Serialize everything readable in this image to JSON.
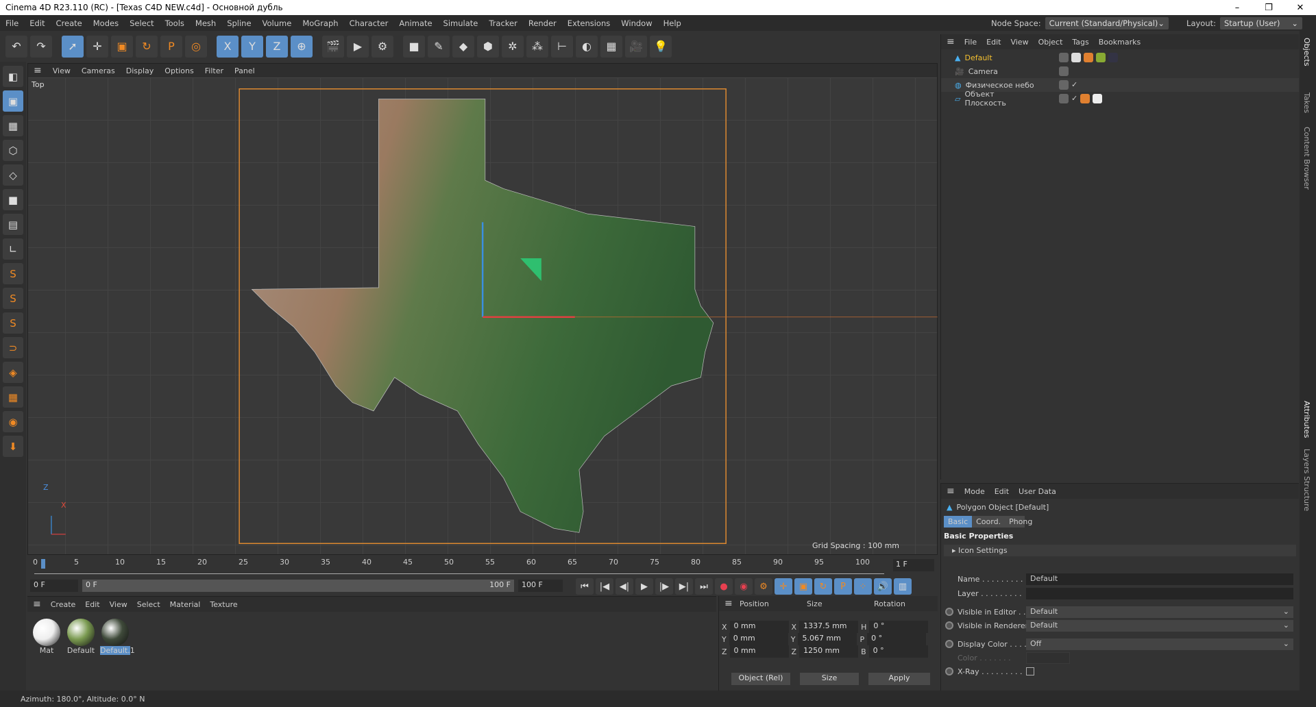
{
  "window": {
    "title": "Cinema 4D R23.110 (RC) - [Texas C4D NEW.c4d] - Основной дубль",
    "controls": [
      "–",
      "❐",
      "✕"
    ]
  },
  "menu": [
    "File",
    "Edit",
    "Create",
    "Modes",
    "Select",
    "Tools",
    "Mesh",
    "Spline",
    "Volume",
    "MoGraph",
    "Character",
    "Animate",
    "Simulate",
    "Tracker",
    "Render",
    "Extensions",
    "Window",
    "Help"
  ],
  "node_space": {
    "label": "Node Space:",
    "value": "Current (Standard/Physical)"
  },
  "layout": {
    "label": "Layout:",
    "value": "Startup (User)"
  },
  "toolbar": [
    {
      "icon": "undo-icon",
      "g": "↶"
    },
    {
      "icon": "redo-icon",
      "g": "↷"
    },
    {
      "icon": "select-icon",
      "g": "➚",
      "on": true
    },
    {
      "icon": "move-icon",
      "g": "✛"
    },
    {
      "icon": "scale-icon",
      "g": "▣"
    },
    {
      "icon": "rotate-icon",
      "g": "↻"
    },
    {
      "icon": "psr-icon",
      "g": "P"
    },
    {
      "icon": "recent-tool-icon",
      "g": "◎"
    },
    {
      "icon": "x-axis-icon",
      "g": "X",
      "on": true
    },
    {
      "icon": "y-axis-icon",
      "g": "Y",
      "on": true
    },
    {
      "icon": "z-axis-icon",
      "g": "Z",
      "on": true
    },
    {
      "icon": "coord-system-icon",
      "g": "⊕",
      "on": true
    },
    {
      "icon": "render-view-icon",
      "g": "🎬"
    },
    {
      "icon": "render-picture-viewer-icon",
      "g": "▶"
    },
    {
      "icon": "render-settings-icon",
      "g": "⚙"
    },
    {
      "icon": "cube-icon",
      "g": "■"
    },
    {
      "icon": "pen-icon",
      "g": "✎"
    },
    {
      "icon": "subdivision-icon",
      "g": "◆"
    },
    {
      "icon": "extrude-icon",
      "g": "⬢"
    },
    {
      "icon": "cloner-icon",
      "g": "✲"
    },
    {
      "icon": "mograph-icon",
      "g": "⁂"
    },
    {
      "icon": "deformer-icon",
      "g": "⊢"
    },
    {
      "icon": "field-icon",
      "g": "◐"
    },
    {
      "icon": "floor-icon",
      "g": "▦"
    },
    {
      "icon": "camera-icon",
      "g": "🎥"
    },
    {
      "icon": "light-icon",
      "g": "💡"
    }
  ],
  "left_tools": [
    "make-editable-icon",
    "model-mode-icon",
    "texture-mode-icon",
    "points-mode-icon",
    "edges-mode-icon",
    "polygons-mode-icon",
    "uv-mode-icon",
    "axis-icon",
    "snap-icon",
    "solo-icon",
    "solo-hierarchy-icon",
    "magnet-icon",
    "workplane-icon",
    "grid-icon",
    "locked-workplane-icon",
    "floor-icon"
  ],
  "viewport": {
    "menu": [
      "View",
      "Cameras",
      "Display",
      "Options",
      "Filter",
      "Panel"
    ],
    "label": "Top",
    "grid_spacing": "Grid Spacing : 100 mm",
    "axis_z": "Z",
    "axis_x": "X"
  },
  "timeline": {
    "ticks": [
      "0",
      "5",
      "10",
      "15",
      "20",
      "25",
      "30",
      "35",
      "40",
      "45",
      "50",
      "55",
      "60",
      "65",
      "70",
      "75",
      "80",
      "85",
      "90",
      "95",
      "100"
    ],
    "current_frame": "1 F",
    "start": "0 F",
    "range_start": "0 F",
    "range_end": "100 F",
    "end": "100 F",
    "current": 1,
    "max": 100
  },
  "transport": [
    "go-start-icon",
    "prev-key-icon",
    "prev-frame-icon",
    "play-icon",
    "next-frame-icon",
    "next-key-icon",
    "go-end-icon",
    "record-icon",
    "autokey-icon",
    "keyframe-selection-icon",
    "key-position-icon",
    "key-scale-icon",
    "key-rotation-icon",
    "key-param-icon",
    "key-pla-icon",
    "sound-icon",
    "timeline-icon"
  ],
  "materials": {
    "menu": [
      "Create",
      "Edit",
      "View",
      "Select",
      "Material",
      "Texture"
    ],
    "items": [
      {
        "name": "Mat",
        "color": "#eeeeee"
      },
      {
        "name": "Default",
        "color": "#7a9a50"
      },
      {
        "name": "Default.1",
        "color": "#3f4a3a"
      }
    ]
  },
  "coords": {
    "headers": [
      "Position",
      "Size",
      "Rotation"
    ],
    "rows": [
      {
        "pl": "X",
        "p": "0 mm",
        "sl": "X",
        "s": "1337.5 mm",
        "rl": "H",
        "r": "0 °"
      },
      {
        "pl": "Y",
        "p": "0 mm",
        "sl": "Y",
        "s": "5.067 mm",
        "rl": "P",
        "r": "0 °"
      },
      {
        "pl": "Z",
        "p": "0 mm",
        "sl": "Z",
        "s": "1250 mm",
        "rl": "B",
        "r": "0 °"
      }
    ],
    "mode": "Object (Rel)",
    "size_mode": "Size",
    "apply": "Apply"
  },
  "objects": {
    "menu": [
      "File",
      "Edit",
      "View",
      "Object",
      "Tags",
      "Bookmarks"
    ],
    "items": [
      {
        "name": "Default",
        "selected": true
      },
      {
        "name": "Camera"
      },
      {
        "name": "Физическое небо"
      },
      {
        "name": "Объект Плоскость"
      }
    ]
  },
  "attributes": {
    "menu": [
      "Mode",
      "Edit",
      "User Data"
    ],
    "title": "Polygon Object [Default]",
    "tabs": [
      "Basic",
      "Coord.",
      "Phong"
    ],
    "section": "Basic Properties",
    "icon_settings": "Icon Settings",
    "name_label": "Name . . . . . . . . .",
    "name": "Default",
    "layer_label": "Layer . . . . . . . . .",
    "layer": "",
    "vis_editor_label": "Visible in Editor . .",
    "vis_editor": "Default",
    "vis_render_label": "Visible in Renderer",
    "vis_render": "Default",
    "display_color_label": "Display Color . . . .",
    "display_color": "Off",
    "color_label": "Color . . . . . . .",
    "xray_label": "X-Ray . . . . . . . . .",
    "xray": false
  },
  "side_tabs": [
    "Objects",
    "Takes",
    "Content Browser",
    "Attributes",
    "Layers",
    "Structure"
  ],
  "status": "Azimuth: 180.0°, Altitude: 0.0°  N"
}
